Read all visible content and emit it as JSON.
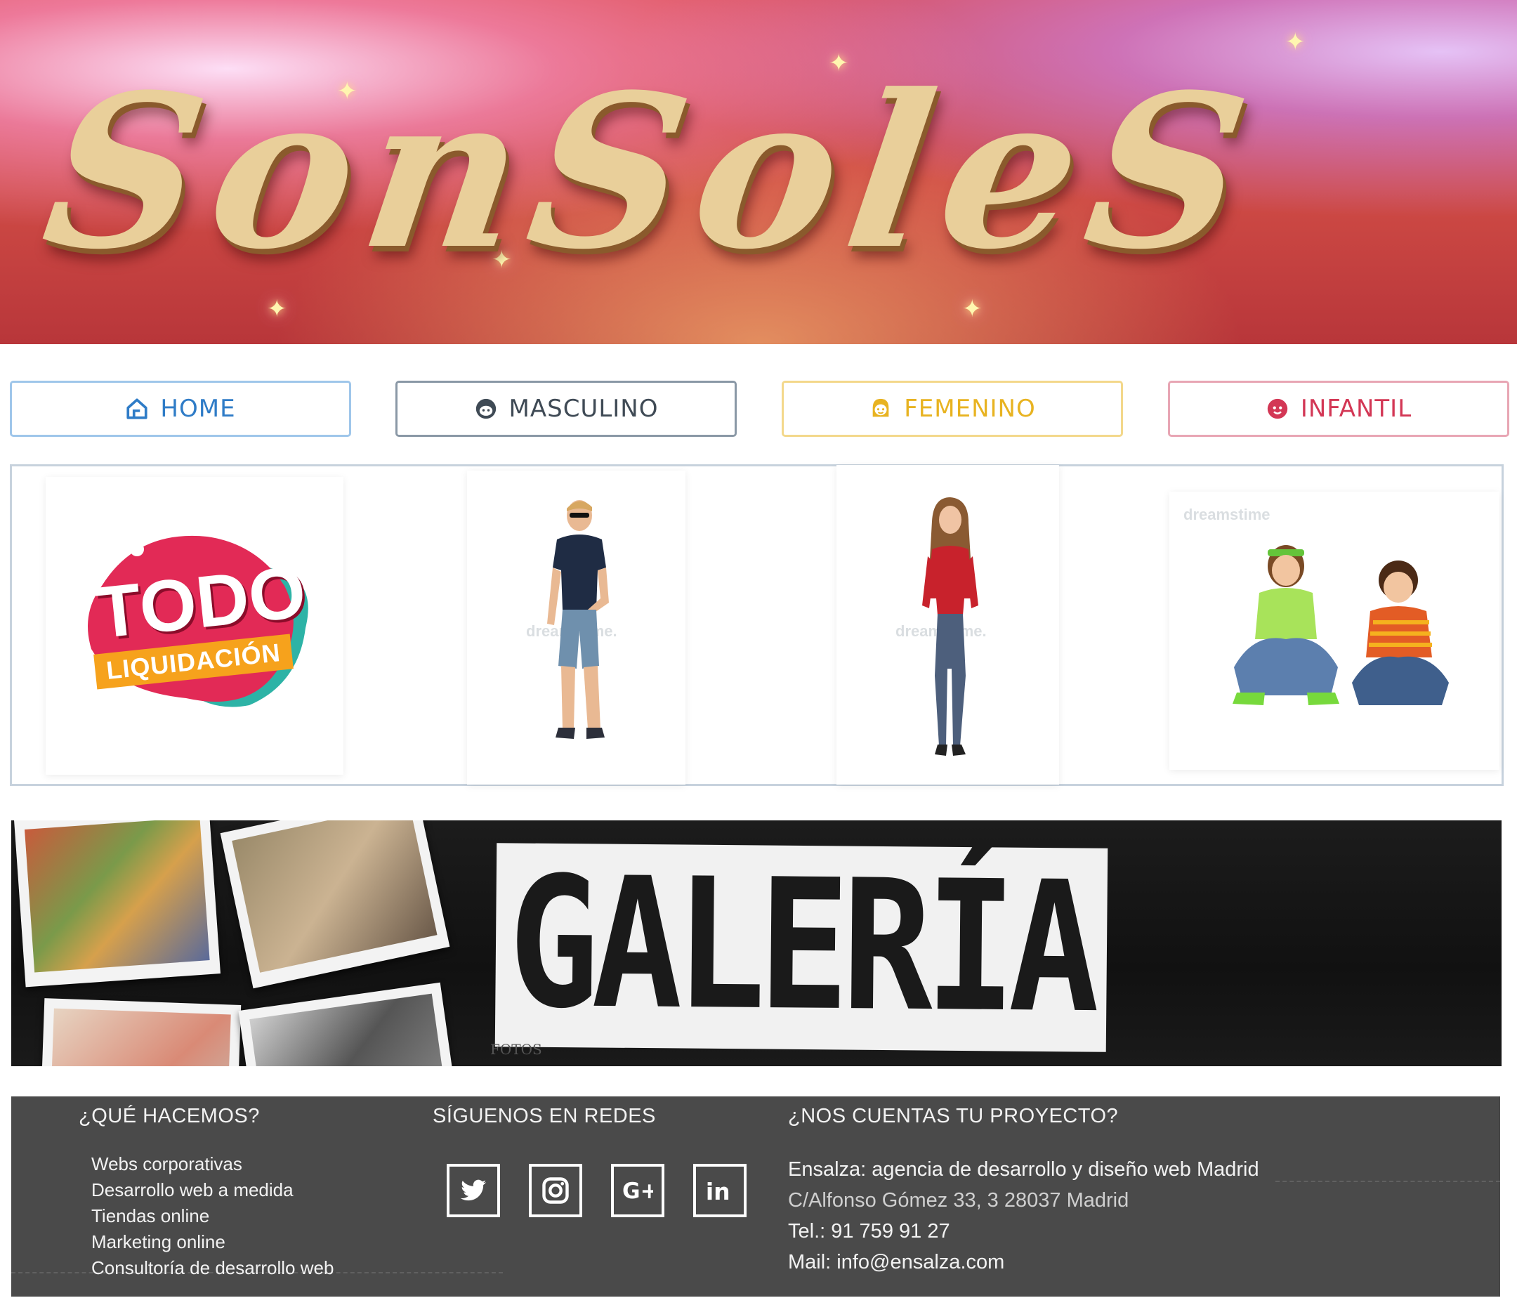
{
  "banner": {
    "title": "SonSoleS"
  },
  "nav": [
    {
      "label": "HOME",
      "icon": "home-icon",
      "color": "#2f7cc7"
    },
    {
      "label": "MASCULINO",
      "icon": "boy-face-icon",
      "color": "#3f4a55"
    },
    {
      "label": "FEMENINO",
      "icon": "girl-face-icon",
      "color": "#e8b321"
    },
    {
      "label": "INFANTIL",
      "icon": "baby-face-icon",
      "color": "#d33755"
    }
  ],
  "products": {
    "promo": {
      "title": "TODO",
      "subtitle": "LIQUIDACIÓN"
    },
    "man_watermark": "dreamstime.",
    "woman_watermark": "dreamstime.",
    "kids_watermark": "dreamstime"
  },
  "galeria": {
    "title": "GALERÍA",
    "credit": "FOTOS"
  },
  "footer": {
    "col1": {
      "heading": "¿QUÉ HACEMOS?",
      "items": [
        "Webs corporativas",
        "Desarrollo web a medida",
        "Tiendas online",
        "Marketing online",
        "Consultoría de desarrollo web"
      ]
    },
    "col2": {
      "heading": "SÍGUENOS EN REDES",
      "icons": [
        "twitter-icon",
        "instagram-icon",
        "google-plus-icon",
        "linkedin-icon"
      ]
    },
    "col3": {
      "heading": "¿NOS CUENTAS TU PROYECTO?",
      "line1": "Ensalza: agencia de desarrollo y diseño web Madrid",
      "address": "C/Alfonso Gómez 33, 3 28037 Madrid",
      "phone": "Tel.: 91 759 91 27",
      "mail": "Mail: info@ensalza.com"
    }
  }
}
